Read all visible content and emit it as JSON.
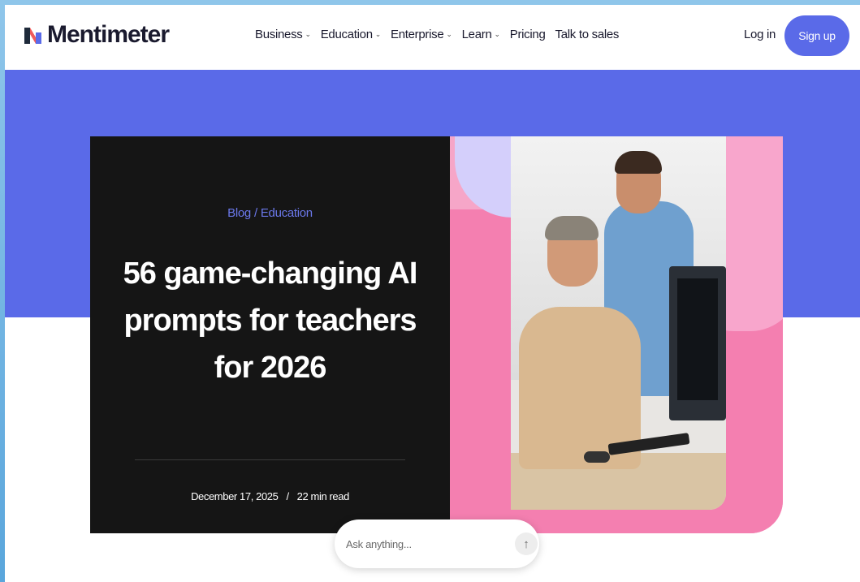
{
  "brand": {
    "name": "Mentimeter"
  },
  "nav": {
    "items": [
      {
        "label": "Business",
        "has_dropdown": true
      },
      {
        "label": "Education",
        "has_dropdown": true
      },
      {
        "label": "Enterprise",
        "has_dropdown": true
      },
      {
        "label": "Learn",
        "has_dropdown": true
      },
      {
        "label": "Pricing",
        "has_dropdown": false
      },
      {
        "label": "Talk to sales",
        "has_dropdown": false
      }
    ],
    "login_label": "Log in",
    "signup_label": "Sign up",
    "chevron_glyph": "⌄"
  },
  "hero": {
    "breadcrumb": {
      "blog": "Blog",
      "sep": "/",
      "category": "Education"
    },
    "title_lines": [
      "56 game-changing AI",
      "prompts for teachers",
      "for 2026"
    ],
    "date": "December 17, 2025",
    "meta_sep": "/",
    "read_time": "22 min read"
  },
  "ask": {
    "placeholder": "Ask anything...",
    "send_icon": "arrow-up-icon",
    "send_glyph": "↑"
  },
  "colors": {
    "accent": "#5a6ae8",
    "hero_dark": "#151515",
    "pink": "#f47fb0",
    "lavender": "#d4cffb",
    "breadcrumb": "#6b78ea"
  }
}
